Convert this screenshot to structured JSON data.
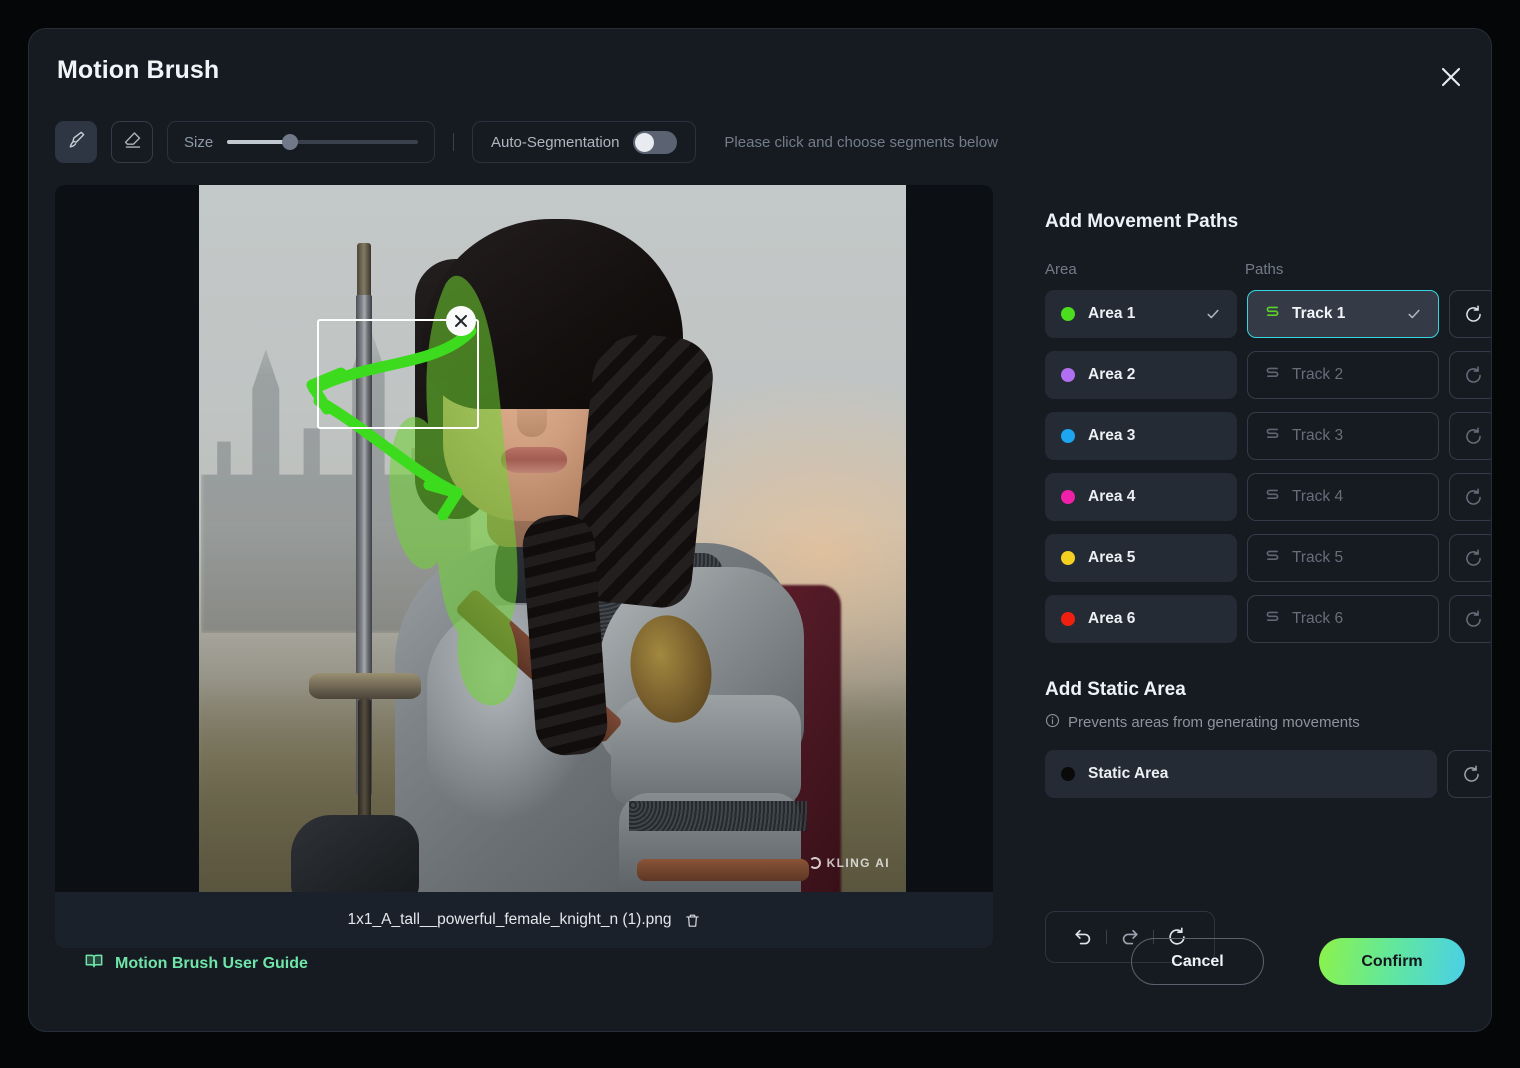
{
  "window": {
    "title": "Motion Brush",
    "close_icon": "close-icon"
  },
  "toolbar": {
    "brush_icon": "brush-icon",
    "eraser_icon": "eraser-icon",
    "size_label": "Size",
    "size_value_percent": 33,
    "auto_segmentation_label": "Auto-Segmentation",
    "auto_segmentation_on": false,
    "hint": "Please click and choose segments below"
  },
  "canvas": {
    "filename": "1x1_A_tall__powerful_female_knight_n (1).png",
    "delete_icon": "trash-icon",
    "watermark": "KLING AI",
    "path_close_icon": "close-icon",
    "mask_color": "#6fd432",
    "path_color": "#3ddb1e"
  },
  "panel": {
    "movement_heading": "Add Movement Paths",
    "col_area": "Area",
    "col_paths": "Paths",
    "rows": [
      {
        "area": "Area 1",
        "color": "#4ade1e",
        "track": "Track 1",
        "selected": true,
        "area_checked": true,
        "reset_icon": "reset-icon"
      },
      {
        "area": "Area 2",
        "color": "#b06ef0",
        "track": "Track 2",
        "selected": false,
        "area_checked": false,
        "reset_icon": "reset-icon"
      },
      {
        "area": "Area 3",
        "color": "#1ea5f0",
        "track": "Track 3",
        "selected": false,
        "area_checked": false,
        "reset_icon": "reset-icon"
      },
      {
        "area": "Area 4",
        "color": "#f020a8",
        "track": "Track 4",
        "selected": false,
        "area_checked": false,
        "reset_icon": "reset-icon"
      },
      {
        "area": "Area 5",
        "color": "#f5d020",
        "track": "Track 5",
        "selected": false,
        "area_checked": false,
        "reset_icon": "reset-icon"
      },
      {
        "area": "Area 6",
        "color": "#f02010",
        "track": "Track 6",
        "selected": false,
        "area_checked": false,
        "reset_icon": "reset-icon"
      }
    ],
    "static_heading": "Add Static Area",
    "static_info": "Prevents areas from generating movements",
    "static_info_icon": "info-icon",
    "static_area_label": "Static Area",
    "static_area_color": "#0a0a0a",
    "static_reset_icon": "reset-icon"
  },
  "history": {
    "undo_icon": "undo-icon",
    "redo_icon": "redo-icon",
    "reset_icon": "reset-icon"
  },
  "footer": {
    "guide_icon": "book-icon",
    "guide_label": "Motion Brush User Guide",
    "cancel_label": "Cancel",
    "confirm_label": "Confirm"
  },
  "theme": {
    "accent_cyan": "#35d6de",
    "accent_green": "#6fe5a8",
    "modal_bg": "#161b22"
  }
}
